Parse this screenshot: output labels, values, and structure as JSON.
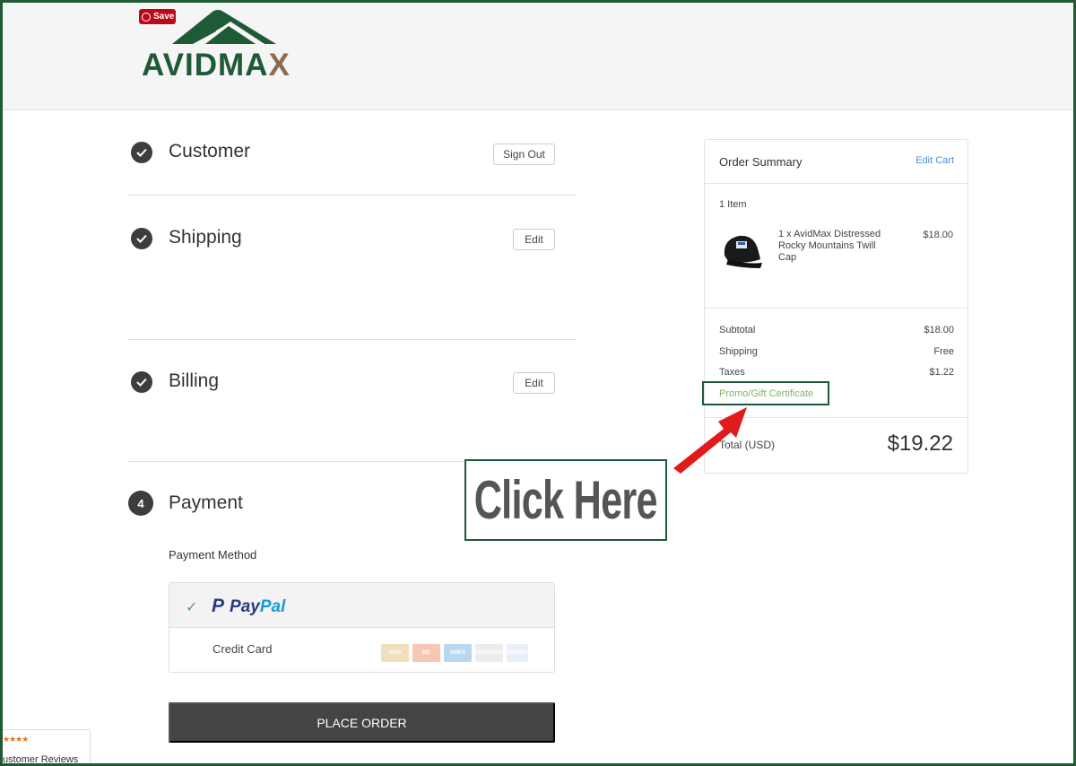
{
  "header": {
    "pin_save": "Save",
    "logo_text_a": "AVIDMA",
    "logo_text_b": "X"
  },
  "steps": {
    "customer": {
      "title": "Customer",
      "action": "Sign Out"
    },
    "shipping": {
      "title": "Shipping",
      "action": "Edit"
    },
    "billing": {
      "title": "Billing",
      "action": "Edit"
    },
    "payment": {
      "number": "4",
      "title": "Payment"
    }
  },
  "payment": {
    "method_label": "Payment Method",
    "paypal_pay": "Pay",
    "paypal_pal": "Pal",
    "credit_card": "Credit Card",
    "cards": [
      "VISA",
      "MC",
      "AMEX",
      "DISCOVER",
      "DINERS"
    ]
  },
  "place_order": "PLACE ORDER",
  "summary": {
    "title": "Order Summary",
    "edit_cart": "Edit Cart",
    "items_count": "1 Item",
    "item_name": "1 x AvidMax Distressed Rocky Mountains Twill Cap",
    "item_price": "$18.00",
    "subtotal_label": "Subtotal",
    "subtotal_value": "$18.00",
    "shipping_label": "Shipping",
    "shipping_value": "Free",
    "taxes_label": "Taxes",
    "taxes_value": "$1.22",
    "promo": "Promo/Gift Certificate",
    "total_label": "Total (USD)",
    "total_value": "$19.22"
  },
  "annotation": {
    "click_here": "Click Here"
  },
  "reviews": {
    "stars": "★★★★",
    "text": "Customer Reviews"
  },
  "colors": {
    "brand_green": "#1f5a36",
    "promo_green": "#7fb56b",
    "arrow_red": "#e01b1b",
    "link_blue": "#4a8fd0"
  }
}
